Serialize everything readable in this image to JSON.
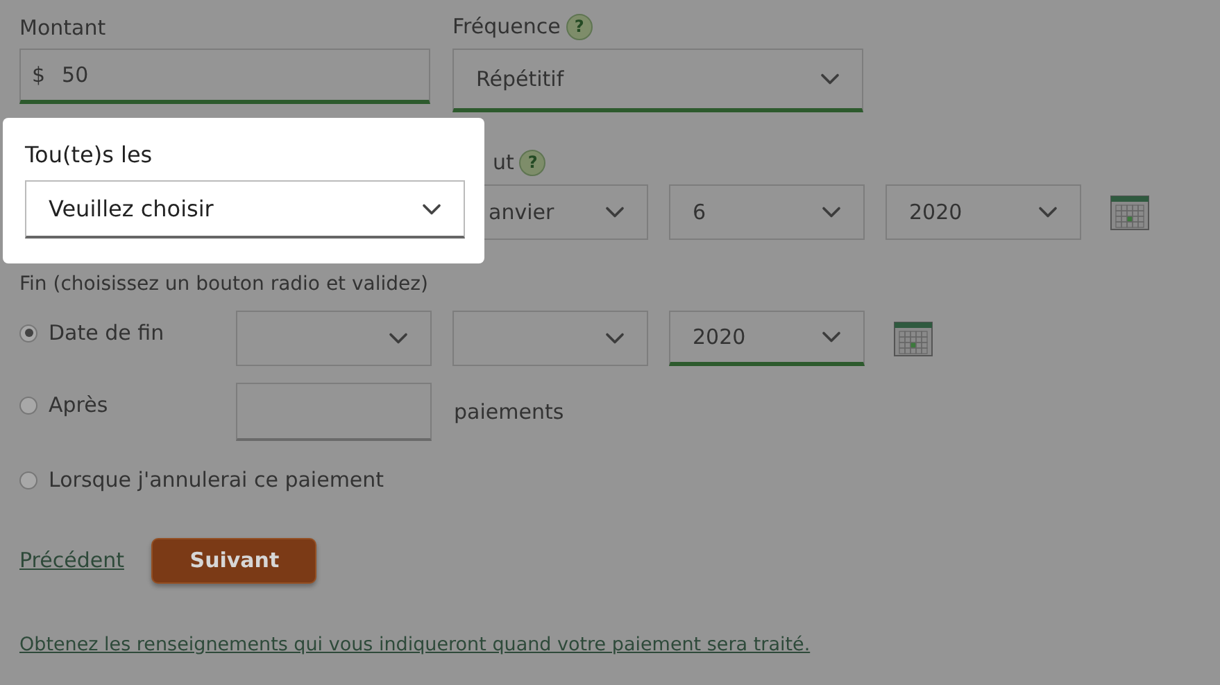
{
  "amount": {
    "label": "Montant",
    "currency": "$",
    "value": "50"
  },
  "frequency": {
    "label": "Fréquence",
    "help": "?",
    "value": "Répétitif"
  },
  "start": {
    "label": "ut",
    "help": "?",
    "selects": [
      "anvier",
      "6",
      "2020"
    ]
  },
  "end": {
    "label": "Fin (choisissez un bouton radio et validez)",
    "options": [
      {
        "kind": "date",
        "label": "Date de fin",
        "selected": true,
        "year": "2020"
      },
      {
        "kind": "count",
        "label": "Après",
        "selected": false,
        "unit": "paiements"
      },
      {
        "kind": "plain",
        "label": "Lorsque j'annulerai ce paiement",
        "selected": false
      }
    ]
  },
  "popup": {
    "label": "Tou(te)s les",
    "value": "Veuillez choisir"
  },
  "nav": {
    "back": "Précédent",
    "next": "Suivant"
  },
  "info_link": "Obtenez les renseignements qui vous indiqueront quand votre paiement sera traité."
}
